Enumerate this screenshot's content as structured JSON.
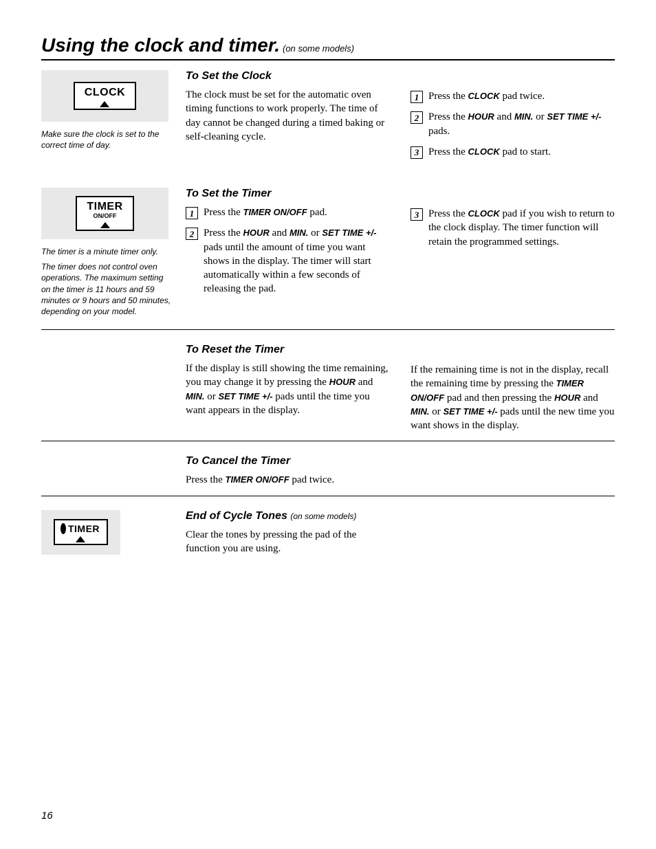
{
  "header": {
    "title": "Using the clock and timer.",
    "suffix": "(on some models)"
  },
  "s1": {
    "pad_main": "CLOCK",
    "caption": "Make sure the clock is set to the correct time of day.",
    "heading": "To Set the Clock",
    "intro": "The clock must be set for the automatic oven timing functions to work properly. The time of day cannot be changed during a timed baking or self-cleaning cycle.",
    "step1_a": "Press the ",
    "step1_b": "CLOCK",
    "step1_c": " pad twice.",
    "step2_a": "Press the ",
    "step2_b": "HOUR",
    "step2_c": " and ",
    "step2_d": "MIN.",
    "step2_e": " or ",
    "step2_f": "SET TIME +/-",
    "step2_g": " pads.",
    "step3_a": "Press the ",
    "step3_b": "CLOCK",
    "step3_c": " pad to start."
  },
  "s2": {
    "pad_main": "TIMER",
    "pad_sub": "ON/OFF",
    "caption1": "The timer is a minute timer only.",
    "caption2": "The timer does not control oven operations. The maximum setting on the timer is 11 hours and 59 minutes or 9 hours and 50 minutes, depending on your model.",
    "heading": "To Set the Timer",
    "l1_a": "Press the ",
    "l1_b": "TIMER ON/OFF",
    "l1_c": " pad.",
    "l2_a": "Press the ",
    "l2_b": "HOUR",
    "l2_c": " and ",
    "l2_d": "MIN.",
    "l2_e": " or ",
    "l2_f": "SET TIME +/-",
    "l2_g": " pads until the amount of time you want shows in the display. The timer will start automatically within a few seconds of releasing the pad.",
    "r3_a": "Press the ",
    "r3_b": "CLOCK",
    "r3_c": " pad if you wish to return to the clock display. The timer function will retain the programmed settings."
  },
  "s3": {
    "heading": "To Reset the Timer",
    "left_a": "If the display is still showing the time remaining, you may change it by pressing the ",
    "left_b": "HOUR",
    "left_c": " and ",
    "left_d": "MIN.",
    "left_e": " or ",
    "left_f": "SET TIME +/-",
    "left_g": "  pads until the time you want appears in the display.",
    "right_a": "If the remaining time is not in the display, recall the remaining time by pressing the ",
    "right_b": "TIMER ON/OFF",
    "right_c": " pad and then pressing the ",
    "right_d": "HOUR",
    "right_e": " and ",
    "right_f": "MIN.",
    "right_g": " or ",
    "right_h": "SET TIME +/-",
    "right_i": " pads until the new time you want shows in the display."
  },
  "s4": {
    "heading": "To Cancel the Timer",
    "text_a": "Press the ",
    "text_b": "TIMER ON/OFF",
    "text_c": " pad twice."
  },
  "s5": {
    "pad_main": "TIMER",
    "heading": "End of Cycle Tones ",
    "heading_suffix": "(on some models)",
    "text": "Clear the tones by pressing the pad of the function you are using."
  },
  "page_number": "16"
}
